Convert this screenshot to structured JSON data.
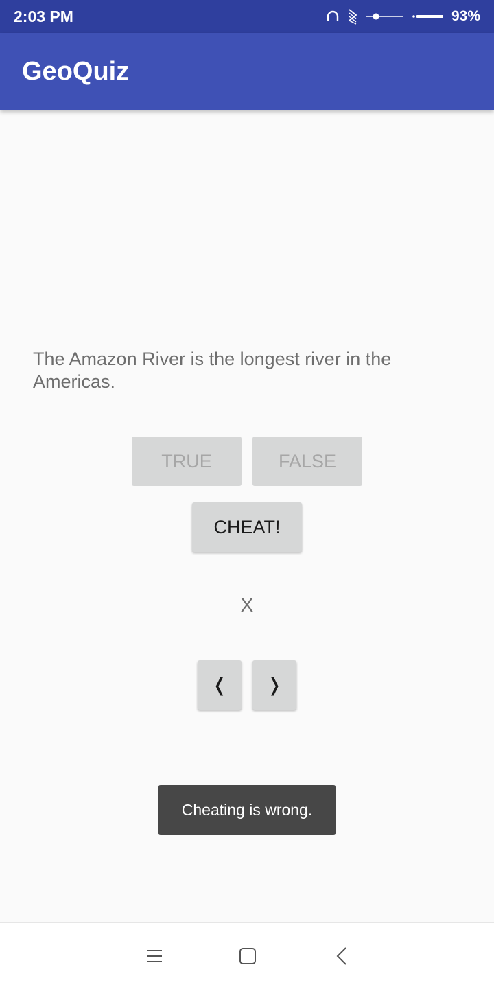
{
  "status_bar": {
    "time": "2:03 PM",
    "battery": "93%",
    "icons": [
      "headphones-icon",
      "data-signal-icon",
      "slider-icon",
      "battery-icon"
    ]
  },
  "app_bar": {
    "title": "GeoQuiz",
    "color": "#3f51b5",
    "status_color": "#2f3f9e"
  },
  "quiz": {
    "question": "The Amazon River is the longest river in the Americas.",
    "true_label": "TRUE",
    "false_label": "FALSE",
    "cheat_label": "CHEAT!",
    "answer_indicator": "X",
    "prev_label": "❬",
    "next_label": "❭"
  },
  "toast": {
    "message": "Cheating is wrong."
  },
  "nav_bar": {
    "icons": [
      "menu-icon",
      "home-icon",
      "back-icon"
    ]
  }
}
